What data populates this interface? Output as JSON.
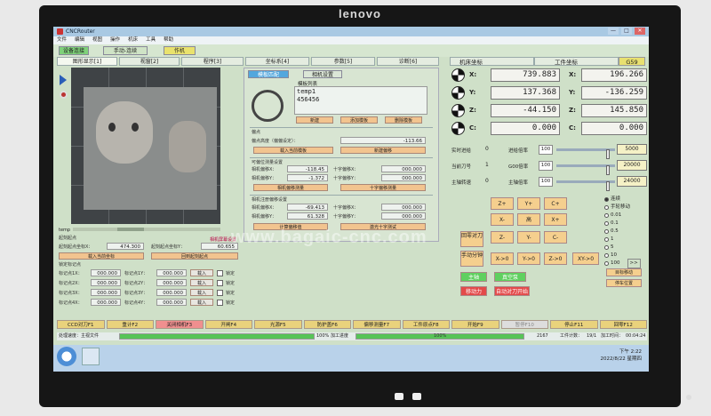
{
  "monitor": {
    "brand": "lenovo"
  },
  "window": {
    "title": "CNCRouter",
    "controls": [
      "—",
      "□",
      "✕"
    ]
  },
  "menu": [
    "文件",
    "编辑",
    "视图",
    "操作",
    "机床",
    "工具",
    "帮助"
  ],
  "modes": {
    "setup": "设备连接",
    "manual": "手动-连续",
    "job": "作机"
  },
  "tabs": [
    "图形显示[1]",
    "视窗[2]",
    "程序[3]",
    "坐标系[4]",
    "参数[5]",
    "诊断[6]"
  ],
  "preview": {
    "caption": "temp",
    "link": "相机屏幕设置"
  },
  "template_panel": {
    "active_tab": "模板匹配",
    "inactive_tab": "相机设置",
    "list_label": "模板列表",
    "items": [
      "temp1",
      "456456"
    ],
    "buttons": [
      "新建",
      "添加模板",
      "删除模板"
    ],
    "section_label": "偏点",
    "point_height_label": "偏点高度（偏偏设定）：",
    "point_height_value": "-113.66",
    "btn_load_temp": "载入当前模板",
    "btn_new_point": "新建偏移",
    "offset_title": "可偏位测量设置",
    "rows": [
      {
        "l1": "相机偏移X：",
        "v1": "-118.45",
        "l2": "十字偏移X：",
        "v2": "000.000"
      },
      {
        "l1": "相机偏移Y：",
        "v1": "-1.372",
        "l2": "十字偏移Y：",
        "v2": "000.000"
      }
    ],
    "btn_camera_offset": "相机偏移测量",
    "btn_cross_offset": "十字偏移测量",
    "reg_title": "相机注册偏移设置",
    "reg_rows": [
      {
        "l1": "相机偏移X：",
        "v1": "-69.413",
        "l2": "十字偏移X：",
        "v2": "000.000"
      },
      {
        "l1": "相机偏移Y：",
        "v1": "61.328",
        "l2": "十字偏移Y：",
        "v2": "000.000"
      }
    ],
    "btn_compute": "计算偏移值",
    "btn_cross_test": "激光十字测试"
  },
  "lower_left": {
    "title1": "起刻起点",
    "start_x_label": "起刻起点坐标X：",
    "start_x_value": "474.300",
    "start_y_label": "起刻起点坐标Y：",
    "start_y_value": "60.655",
    "btn_load_coord": "载入当前坐标",
    "btn_go_start": "回到起刻起点",
    "title2": "锁定标记点",
    "marks": [
      {
        "l1": "标记点1X：",
        "v1": "000.000",
        "l2": "标记点1Y：",
        "v2": "000.000",
        "btn": "载入",
        "chk": "锁定"
      },
      {
        "l1": "标记点2X：",
        "v1": "000.000",
        "l2": "标记点2Y：",
        "v2": "000.000",
        "btn": "载入",
        "chk": "锁定"
      },
      {
        "l1": "标记点3X：",
        "v1": "000.000",
        "l2": "标记点3Y：",
        "v2": "000.000",
        "btn": "载入",
        "chk": "锁定"
      },
      {
        "l1": "标记点4X：",
        "v1": "000.000",
        "l2": "标记点4Y：",
        "v2": "000.000",
        "btn": "载入",
        "chk": "锁定"
      }
    ]
  },
  "coords": {
    "machine_header": "机床坐标",
    "work_header": "工件坐标",
    "wcs": "G59",
    "axes": [
      {
        "label": "X:",
        "machine": "739.883",
        "work": "196.266"
      },
      {
        "label": "Y:",
        "machine": "137.368",
        "work": "-136.259"
      },
      {
        "label": "Z:",
        "machine": "-44.150",
        "work": "145.850"
      },
      {
        "label": "C:",
        "machine": "0.000",
        "work": "0.000"
      }
    ]
  },
  "rates": [
    {
      "label": "实时进给",
      "value": "0",
      "label2": "进给倍率",
      "pct": "100",
      "knob": 0.9,
      "set": "5000"
    },
    {
      "label": "当前刀号",
      "value": "1",
      "label2": "G00倍率",
      "pct": "100",
      "knob": 0.9,
      "set": "20000"
    },
    {
      "label": "主轴转速",
      "value": "0",
      "label2": "主轴倍率",
      "pct": "100",
      "knob": 0.9,
      "set": "24000"
    }
  ],
  "jog": {
    "z_up": "Z+",
    "y_up": "Y+",
    "c_up": "C+",
    "x_minus": "X-",
    "home": "高",
    "x_plus": "X+",
    "return_zero": "回零对刀",
    "z_down": "Z-",
    "y_down": "Y-",
    "c_down": "C-",
    "manual_btn": "手动分钟",
    "x_to_0": "X->0",
    "y_to_0": "Y->0",
    "z_to_0": "Z->0",
    "xy_to_0": "XY->0",
    "spindle": "主轴",
    "vacuum": "真空泵",
    "sync": "移动力",
    "sensor": "自动对刀开始"
  },
  "step_modes": {
    "items": [
      {
        "label": "连续",
        "on": true
      },
      {
        "label": "手轮移动",
        "on": false
      },
      {
        "label": "0.01",
        "on": false
      },
      {
        "label": "0.1",
        "on": false
      },
      {
        "label": "0.5",
        "on": false
      },
      {
        "label": "1",
        "on": false
      },
      {
        "label": "5",
        "on": false
      },
      {
        "label": "10",
        "on": false
      },
      {
        "label": "100",
        "on": false
      }
    ],
    "more": ">>",
    "btn_target": "目标移动",
    "btn_stop_pos": "停车位置"
  },
  "fkeys": [
    {
      "label": "CCD对刀F1",
      "style": "normal"
    },
    {
      "label": "重计F2",
      "style": "normal"
    },
    {
      "label": "关闭相机F3",
      "style": "pink"
    },
    {
      "label": "开闸F4",
      "style": "normal"
    },
    {
      "label": "光源F5",
      "style": "normal"
    },
    {
      "label": "防护盖F6",
      "style": "normal"
    },
    {
      "label": "偏移测量F7",
      "style": "normal"
    },
    {
      "label": "工件原点F8",
      "style": "normal"
    },
    {
      "label": "开始F9",
      "style": "normal"
    },
    {
      "label": "暂停F10",
      "style": "gray"
    },
    {
      "label": "停止F11",
      "style": "normal"
    },
    {
      "label": "回零F12",
      "style": "normal"
    }
  ],
  "status": {
    "state_label": "处理速度：主视文件",
    "progress1": "100%",
    "progress1_value": 1.0,
    "process_label": "加工进度",
    "progress2": "100%",
    "progress2_value": 1.0,
    "lines": "2167",
    "job_count_label": "工件计数：",
    "job_count": "19/1",
    "time_label": "加工时间：",
    "time": "00:04:24"
  },
  "taskbar": {
    "time": "下午 2:22",
    "date": "2022/8/22 星期四"
  },
  "watermark": "www.bagaic-cnc.com"
}
